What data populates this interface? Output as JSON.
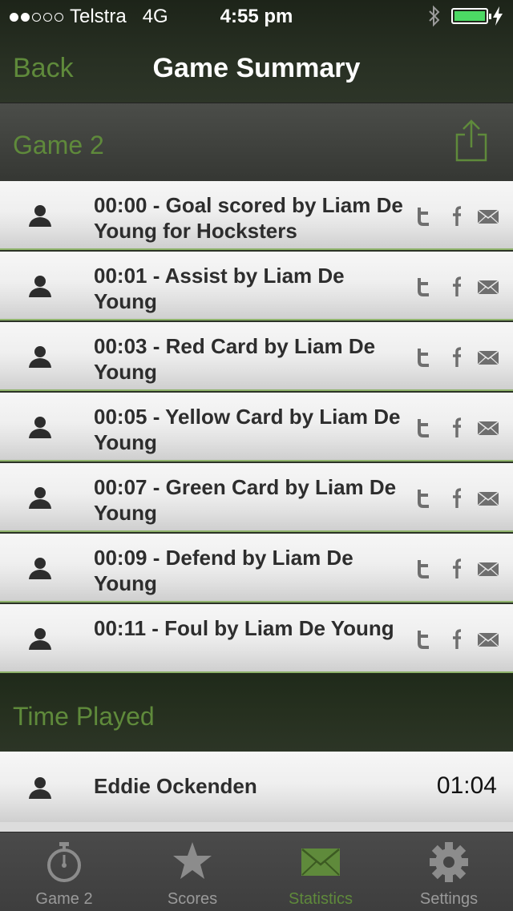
{
  "status_bar": {
    "carrier": "Telstra",
    "network": "4G",
    "time": "4:55 pm",
    "signal_dots_filled": 2,
    "signal_dots_total": 5
  },
  "nav": {
    "back_label": "Back",
    "title": "Game Summary"
  },
  "game_section": {
    "title": "Game 2",
    "share_icon": "share-icon"
  },
  "events": [
    {
      "text": "00:00 - Goal scored by Liam De Young for Hocksters"
    },
    {
      "text": "00:01 - Assist by Liam De Young"
    },
    {
      "text": "00:03 - Red Card by Liam De Young"
    },
    {
      "text": "00:05 - Yellow Card by Liam De Young"
    },
    {
      "text": "00:07 - Green Card by Liam De Young"
    },
    {
      "text": "00:09 - Defend by Liam De Young"
    },
    {
      "text": "00:11 - Foul by Liam De Young"
    }
  ],
  "time_played": {
    "title": "Time Played",
    "players": [
      {
        "name": "Eddie Ockenden",
        "time": "01:04"
      }
    ]
  },
  "tabs": [
    {
      "label": "Game 2",
      "icon": "stopwatch-icon"
    },
    {
      "label": "Scores",
      "icon": "star-icon"
    },
    {
      "label": "Statistics",
      "icon": "envelope-icon",
      "active": true
    },
    {
      "label": "Settings",
      "icon": "gear-icon"
    }
  ],
  "colors": {
    "accent": "#5f8a3b",
    "battery": "#4cd964"
  }
}
